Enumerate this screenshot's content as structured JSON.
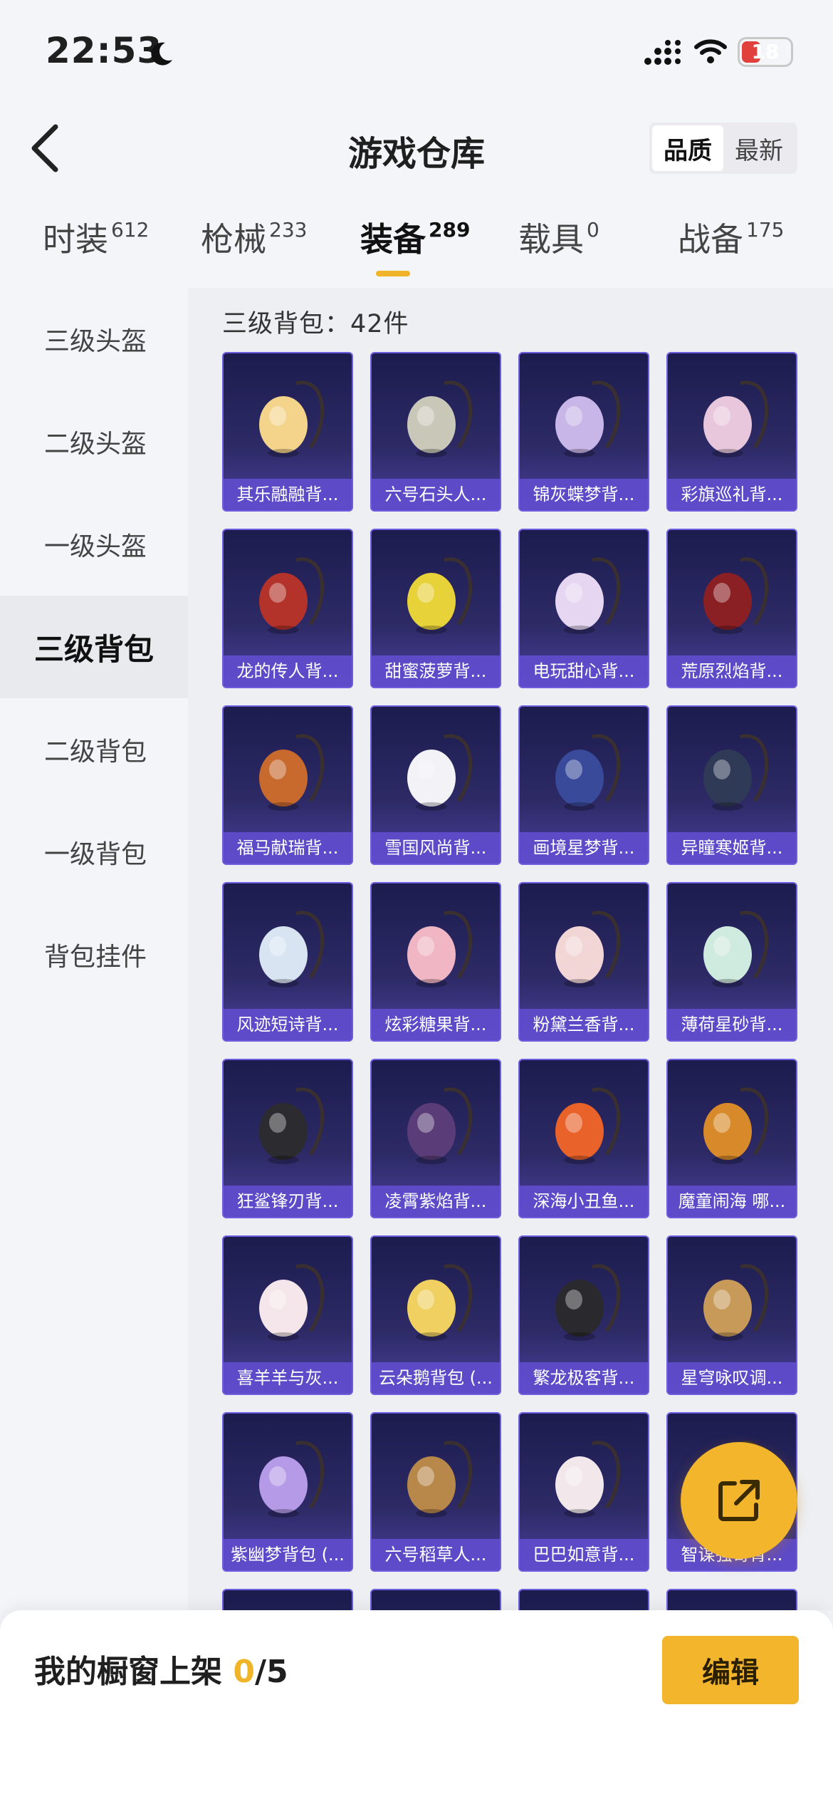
{
  "status_bar": {
    "time": "22:53",
    "battery": "18"
  },
  "header": {
    "title": "游戏仓库",
    "sort_options": [
      "品质",
      "最新"
    ],
    "sort_selected": "品质"
  },
  "tabs": [
    {
      "label": "时装",
      "count": "612"
    },
    {
      "label": "枪械",
      "count": "233"
    },
    {
      "label": "装备",
      "count": "289",
      "active": true
    },
    {
      "label": "载具",
      "count": "0"
    },
    {
      "label": "战备",
      "count": "175"
    }
  ],
  "sidebar": {
    "items": [
      "三级头盔",
      "二级头盔",
      "一级头盔",
      "三级背包",
      "二级背包",
      "一级背包",
      "背包挂件"
    ],
    "active_index": 3
  },
  "content": {
    "section_title": "三级背包：42件",
    "items": [
      "其乐融融背...",
      "六号石头人...",
      "锦灰蝶梦背...",
      "彩旗巡礼背...",
      "龙的传人背...",
      "甜蜜菠萝背...",
      "电玩甜心背...",
      "荒原烈焰背...",
      "福马献瑞背...",
      "雪国风尚背...",
      "画境星梦背...",
      "异瞳寒姬背...",
      "风迹短诗背...",
      "炫彩糖果背...",
      "粉黛兰香背...",
      "薄荷星砂背...",
      "狂鲨锋刃背...",
      "凌霄紫焰背...",
      "深海小丑鱼...",
      "魔童闹海 哪...",
      "喜羊羊与灰...",
      "云朵鹅背包 (...",
      "繁龙极客背...",
      "星穹咏叹调...",
      "紫幽梦背包 (...",
      "六号稻草人...",
      "巴巴如意背...",
      "智谋强哥背..."
    ],
    "item_accents": [
      "#f3d48a",
      "#c9c7b8",
      "#c8b6e8",
      "#e8c7dc",
      "#b3322a",
      "#e8d23a",
      "#e6d6f2",
      "#8a1f24",
      "#c8692e",
      "#f2f2f7",
      "#3a4a9a",
      "#2f3a56",
      "#d8e4f2",
      "#f0b6c4",
      "#f2d6d6",
      "#cfeadf",
      "#2b2b30",
      "#5a3d78",
      "#e8622a",
      "#d88a2a",
      "#f4e6ea",
      "#f0d060",
      "#2a2a2e",
      "#c89a5a",
      "#b59ae8",
      "#b8874a",
      "#f2e8ec",
      "#8a6ad8"
    ]
  },
  "showcase": {
    "label": "我的橱窗上架",
    "current": "0",
    "total": "/5"
  },
  "edit_label": "编辑"
}
